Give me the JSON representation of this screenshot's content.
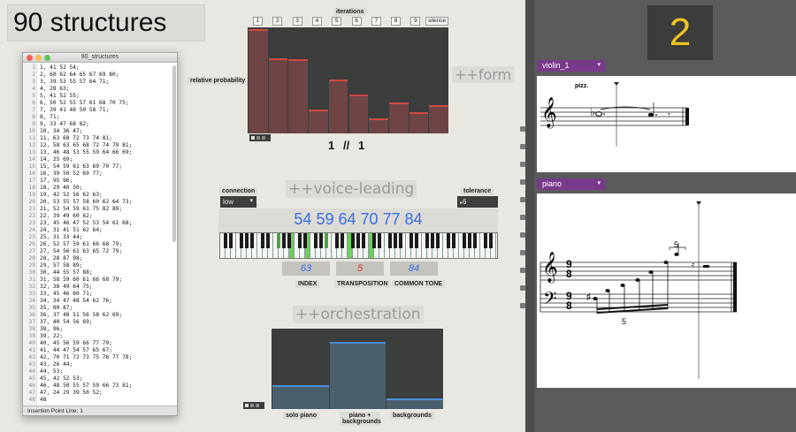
{
  "title": "90 structures",
  "editor": {
    "window_title": "90_structures",
    "status": "Insertion Point Line: 1",
    "lines": [
      "1, 41 52 54;",
      "2, 60 62 64 65 67 69 80;",
      "3, 39 53 55 57 64 71;",
      "4, 28 63;",
      "5, 41 52 55;",
      "6, 50 52 55 57 61 68 70 75;",
      "7, 39 41 48 50 58 71;",
      "8, 71;",
      "9, 33 47 68 82;",
      "10, 34 36 47;",
      "11, 63 68 72 73 74 81;",
      "12, 58 63 65 68 72 74 79 81;",
      "13, 46 48 53 55 59 64 66 69;",
      "14, 25 69;",
      "15, 54 59 61 63 69 70 77;",
      "16, 39 50 52 69 77;",
      "17, 95 96;",
      "18, 29 40 50;",
      "19, 42 52 56 62 63;",
      "20, 53 55 57 58 60 62 64 73;",
      "21, 52 54 59 61 75 82 89;",
      "22, 39 49 60 62;",
      "23, 45 46 47 52 53 54 61 68;",
      "24, 31 41 51 62 64;",
      "25, 31 33 44;",
      "26, 52 57 59 61 66 68 79;",
      "27, 54 56 61 63 65 72 79;",
      "28, 28 87 98;",
      "29, 57 58 89;",
      "30, 44 55 57 88;",
      "31, 58 59 60 61 66 68 79;",
      "32, 38 49 64 75;",
      "33, 45 46 60 71;",
      "34, 34 47 48 54 62 76;",
      "35, 80 87;",
      "36, 37 48 51 56 58 62 69;",
      "37, 40 54 56 69;",
      "38, 96;",
      "39, 22;",
      "40, 45 56 59 66 77 79;",
      "41, 44 47 54 57 65 67;",
      "42, 70 71 72 73 75 76 77 78;",
      "43, 26 44;",
      "44, 53;",
      "45, 42 52 53;",
      "46, 48 50 55 57 59 66 73 81;",
      "47, 24 29 39 50 52;",
      "48"
    ]
  },
  "form": {
    "watermark": "++form",
    "iterations_label": "iterations",
    "ticks": [
      "1",
      "2",
      "3",
      "4",
      "5",
      "6",
      "7",
      "8",
      "9"
    ],
    "silence_label": "silence",
    "prob_label": "relative probability",
    "counter_a": "1",
    "counter_sep": "//",
    "counter_b": "1",
    "bar_values": [
      1.0,
      0.72,
      0.71,
      0.23,
      0.52,
      0.37,
      0.14,
      0.3,
      0.2,
      0.27
    ]
  },
  "voice_leading": {
    "watermark": "++voice-leading",
    "connection_label": "connection",
    "connection_value": "low",
    "tolerance_label": "tolerance",
    "tolerance_value": "6",
    "chord": "54 59 64 70 77 84",
    "active_midi": [
      54,
      59,
      64,
      70,
      77,
      84
    ],
    "index_value": "63",
    "index_label": "INDEX",
    "transposition_value": "5",
    "transposition_label": "TRANSPOSITION",
    "common_tone_value": "84",
    "common_tone_label": "COMMON TONE"
  },
  "orchestration": {
    "watermark": "++orchestration",
    "options": [
      "solo piano",
      "piano + backgrounds",
      "backgrounds"
    ],
    "values": [
      0.3,
      0.85,
      0.13
    ]
  },
  "score": {
    "counter": "2",
    "violin_name": "violin_1",
    "piano_name": "piano",
    "violin_marking": "pizz.",
    "tuplet_top": "5",
    "tuplet_bottom": "5",
    "time_top": "9",
    "time_bottom": "8"
  },
  "colors": {
    "form_bar": "#6e4444",
    "form_bar_top": "#d04a44",
    "orch_bar": "#4b5e6c",
    "orch_bar_top": "#4a8fd8",
    "chord_text": "#3a6ee8",
    "counter_yellow": "#f1c31d",
    "instrument_tab": "#7a3a8c"
  }
}
